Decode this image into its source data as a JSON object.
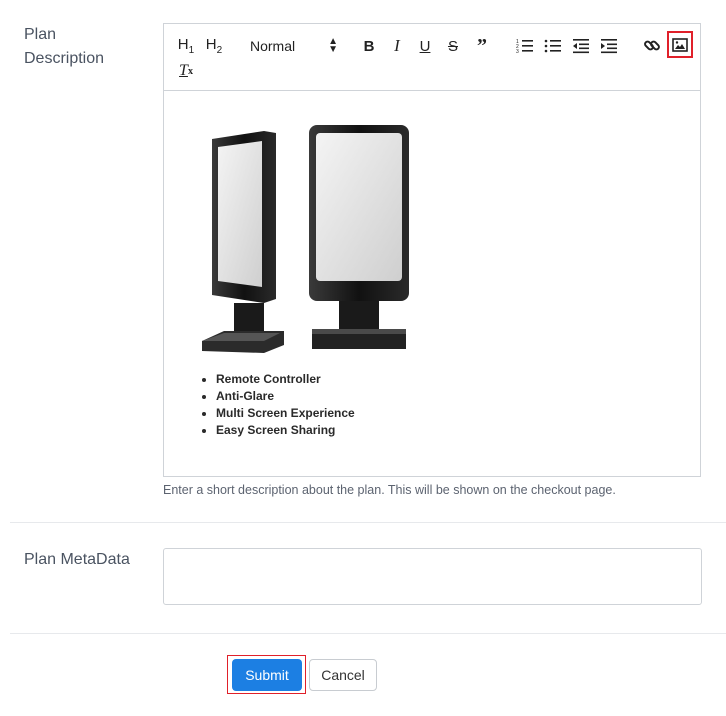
{
  "form": {
    "plan_description_label": "Plan Description",
    "plan_description_help": "Enter a short description about the plan. This will be shown on the checkout page.",
    "plan_metadata_label": "Plan MetaData",
    "plan_metadata_value": "",
    "submit_label": "Submit",
    "cancel_label": "Cancel"
  },
  "toolbar": {
    "h1": "H1",
    "h2": "H2",
    "format_select": "Normal",
    "highlighted_button": "image-icon",
    "icons": [
      "bold-icon",
      "italic-icon",
      "underline-icon",
      "strikethrough-icon",
      "blockquote-icon",
      "ordered-list-icon",
      "bullet-list-icon",
      "outdent-icon",
      "indent-icon",
      "link-icon",
      "image-icon",
      "clear-format-icon"
    ]
  },
  "editor_content": {
    "image_alt": "digital signage kiosks",
    "bullets": [
      "Remote Controller",
      "Anti-Glare",
      "Multi Screen Experience",
      "Easy Screen Sharing"
    ]
  },
  "colors": {
    "accent": "#1c7fe3",
    "highlight": "#e0202a"
  }
}
